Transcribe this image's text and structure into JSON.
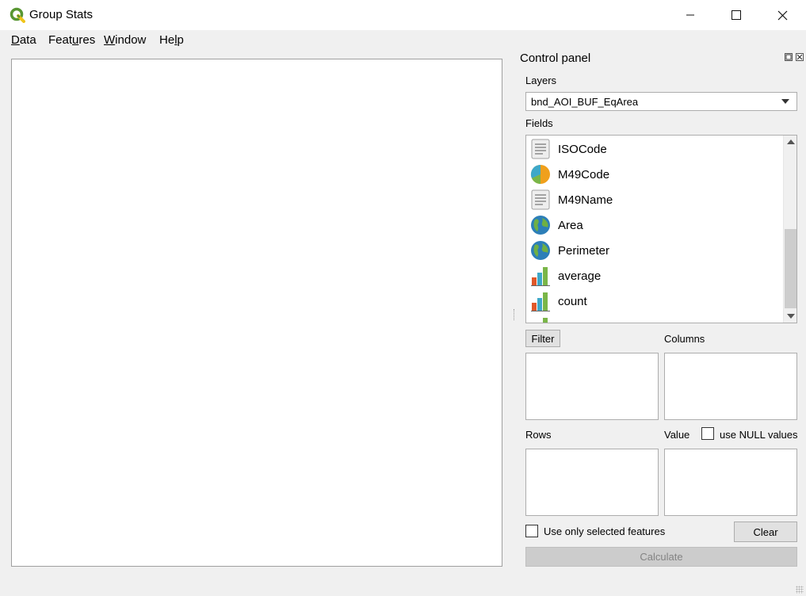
{
  "window": {
    "title": "Group Stats",
    "controls": {
      "minimize": "minimize-icon",
      "maximize": "maximize-icon",
      "close": "close-icon"
    }
  },
  "menubar": {
    "items": [
      {
        "label_u": "D",
        "label_rest": "ata"
      },
      {
        "label_pre": "Feat",
        "label_u": "u",
        "label_rest": "res"
      },
      {
        "label_u": "W",
        "label_rest": "indow"
      },
      {
        "label_pre": "He",
        "label_u": "l",
        "label_rest": "p"
      }
    ]
  },
  "control_panel": {
    "title": "Control panel",
    "layers_label": "Layers",
    "layer_selected": "bnd_AOI_BUF_EqArea",
    "fields_label": "Fields",
    "fields": [
      {
        "name": "ISOCode",
        "icon": "text-field-icon"
      },
      {
        "name": "M49Code",
        "icon": "numeric-field-icon"
      },
      {
        "name": "M49Name",
        "icon": "text-field-icon"
      },
      {
        "name": "Area",
        "icon": "geometry-field-icon"
      },
      {
        "name": "Perimeter",
        "icon": "geometry-field-icon"
      },
      {
        "name": "average",
        "icon": "calculation-field-icon"
      },
      {
        "name": "count",
        "icon": "calculation-field-icon"
      }
    ],
    "filter_button": "Filter",
    "columns_label": "Columns",
    "rows_label": "Rows",
    "value_label": "Value",
    "use_null_label": "use NULL values",
    "use_null_checked": false,
    "selected_only_label": "Use only selected features",
    "selected_only_checked": false,
    "clear_button": "Clear",
    "calculate_button": "Calculate"
  },
  "colors": {
    "qgis_green": "#589632",
    "qgis_yellow": "#f0c419",
    "calculate_disabled_text": "#838383"
  }
}
